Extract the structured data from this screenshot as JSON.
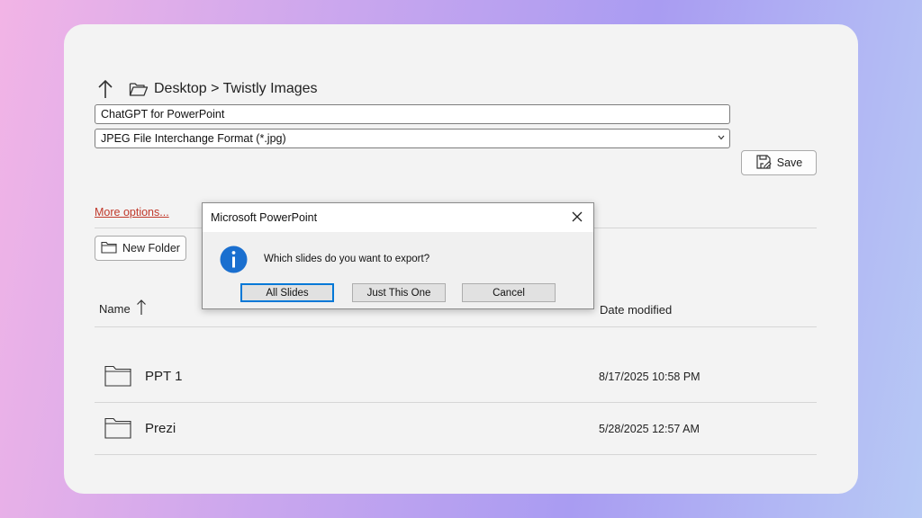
{
  "save_dialog": {
    "breadcrumb": "Desktop > Twistly Images",
    "file_name_value": "ChatGPT for PowerPoint",
    "file_type_value": "JPEG File Interchange Format (*.jpg)",
    "save_label": "Save",
    "more_options_label": "More options...",
    "new_folder_label": "New Folder",
    "columns": {
      "name": "Name",
      "date_modified": "Date modified"
    },
    "rows": [
      {
        "name": "PPT 1",
        "date": "8/17/2025 10:58 PM"
      },
      {
        "name": "Prezi",
        "date": "5/28/2025 12:57 AM"
      }
    ],
    "icons": [
      "up-arrow-icon",
      "folder-open-icon",
      "chevron-down-icon",
      "save-icon",
      "new-folder-icon",
      "sort-arrow-icon",
      "folder-icon"
    ]
  },
  "message_box": {
    "title": "Microsoft PowerPoint",
    "message": "Which slides do you want to export?",
    "buttons": {
      "all": "All Slides",
      "one": "Just This One",
      "cancel": "Cancel"
    },
    "icons": [
      "info-icon",
      "close-icon"
    ]
  },
  "colors": {
    "accent": "#0078d7",
    "link": "#c0392b",
    "info": "#1a6fcf"
  }
}
